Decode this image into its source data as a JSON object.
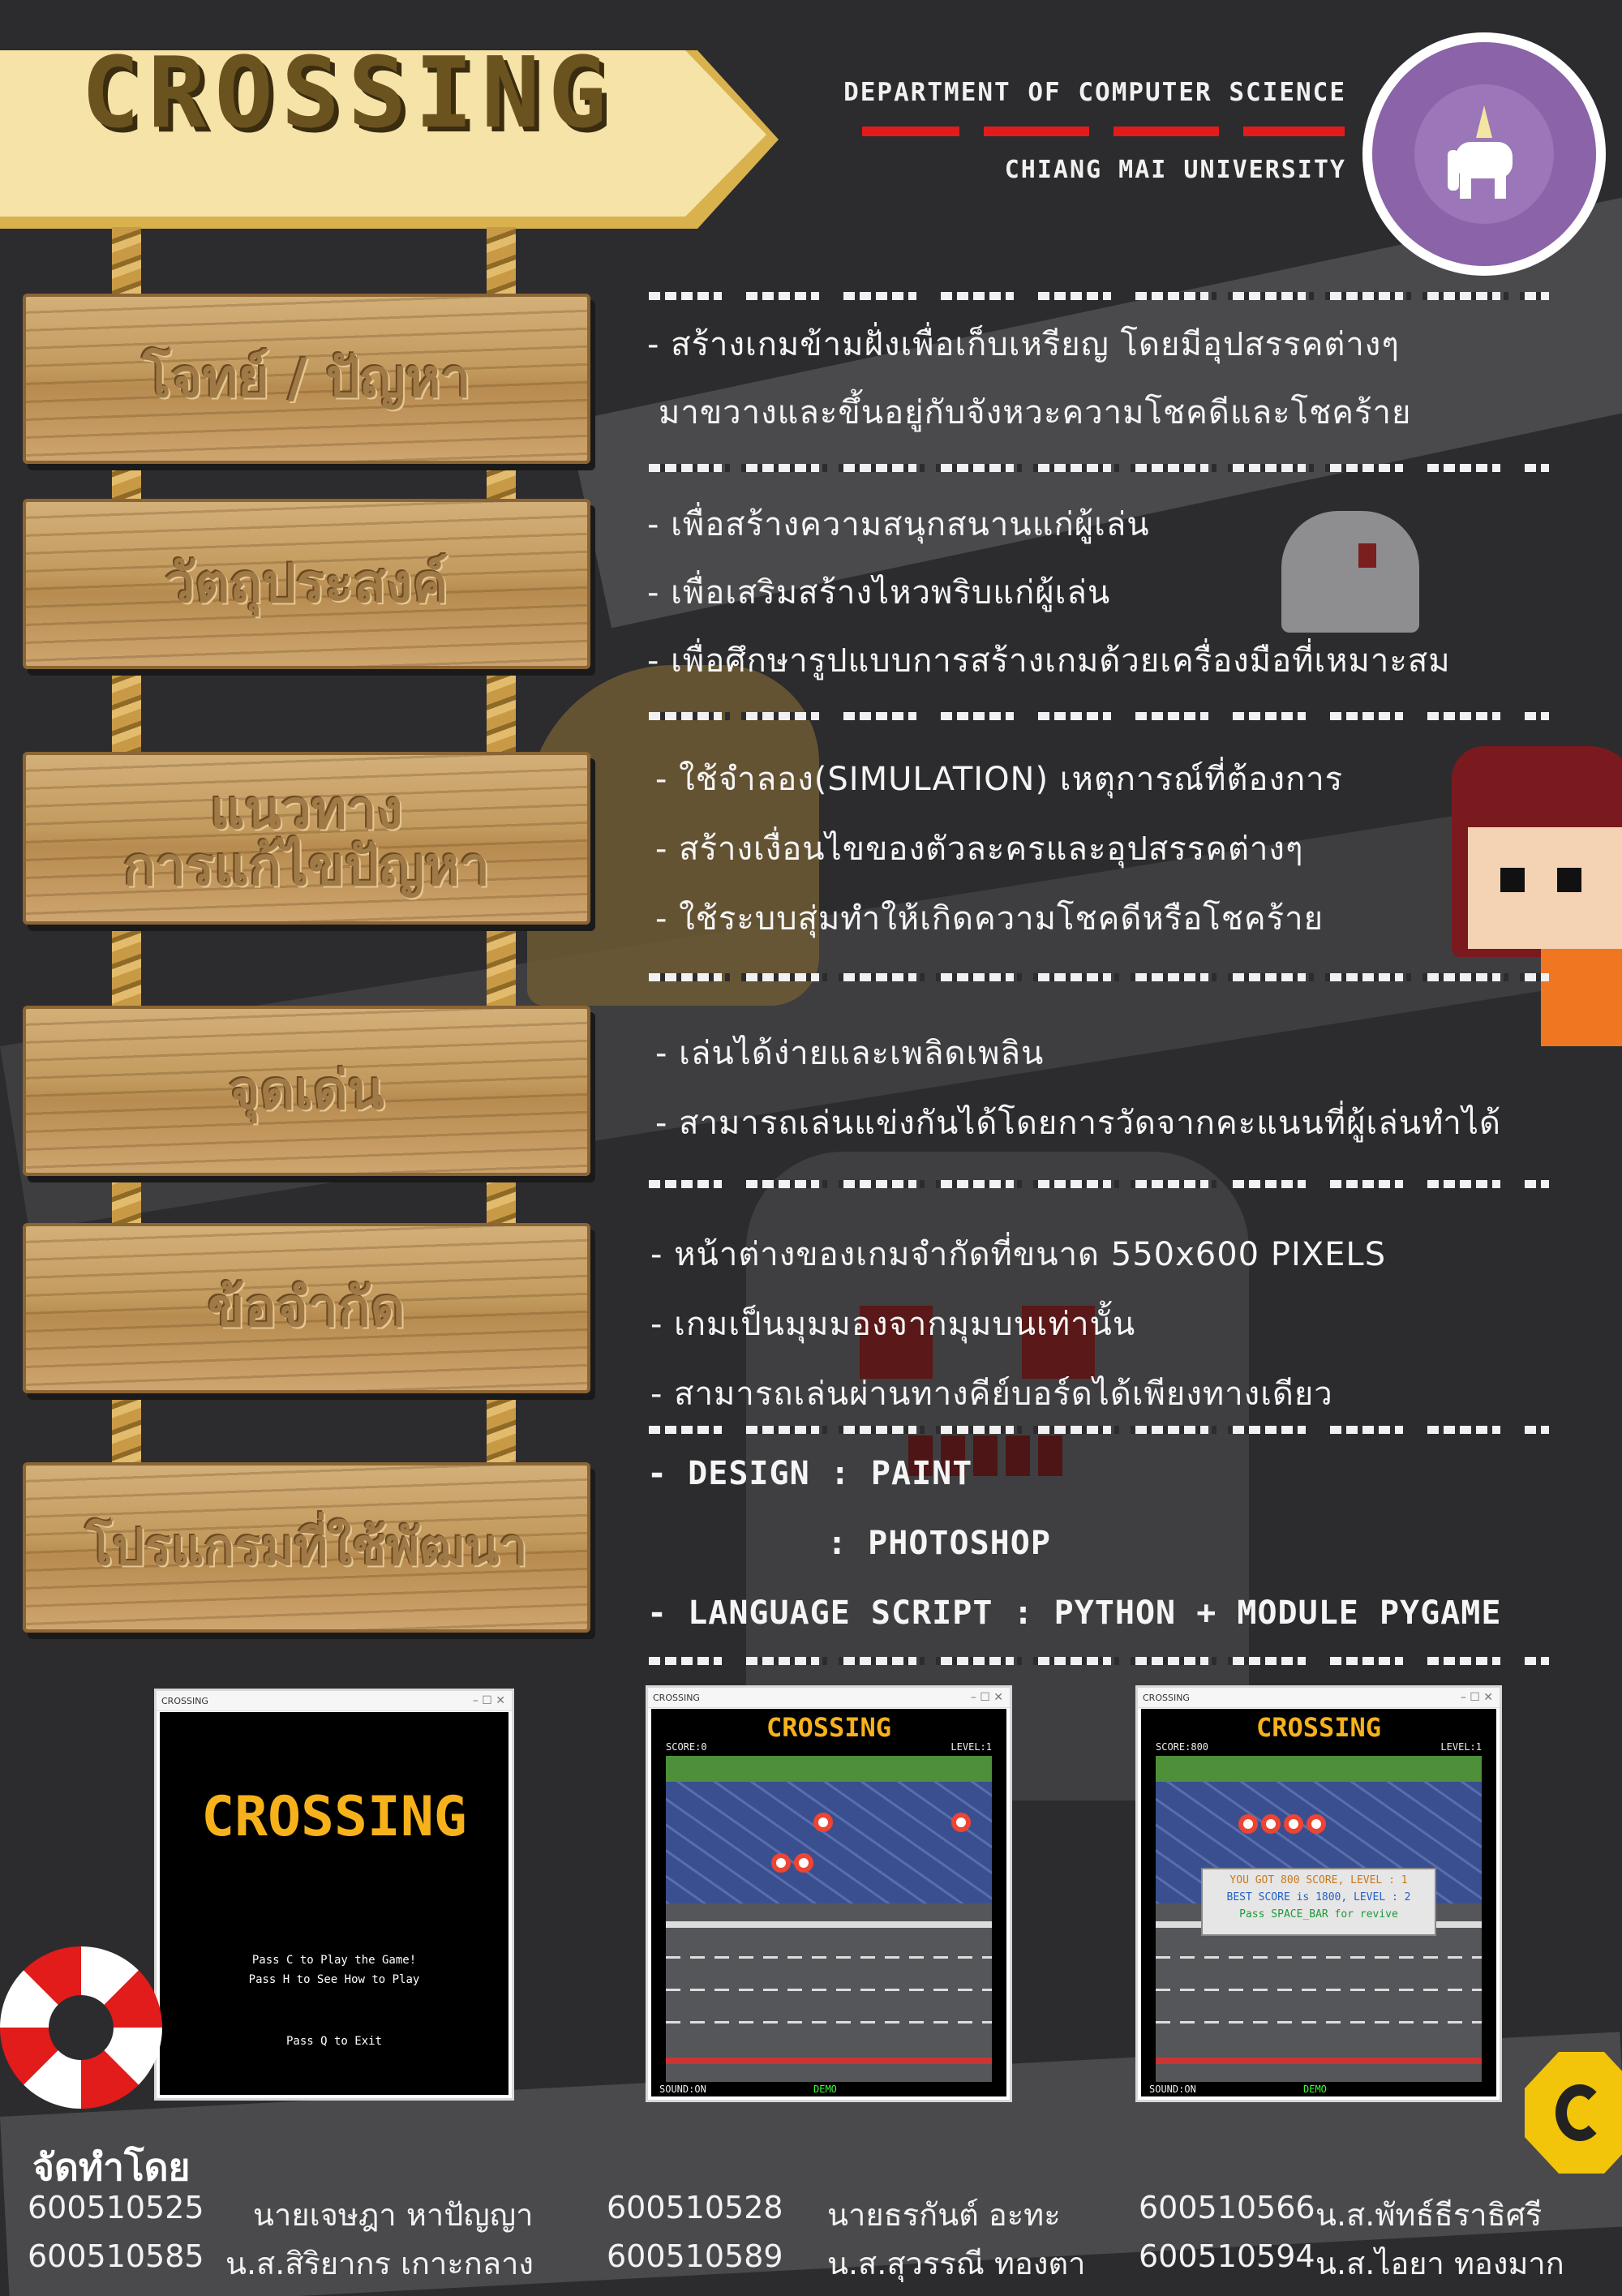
{
  "header": {
    "title": "CROSSING",
    "department": "DEPARTMENT OF COMPUTER SCIENCE",
    "university": "CHIANG MAI UNIVERSITY"
  },
  "sections": [
    {
      "board": "โจทย์ / ปัญหา",
      "lines": [
        "- สร้างเกมข้ามฝั่งเพื่อเก็บเหรียญ โดยมีอุปสรรคต่างๆ",
        " มาขวางและขึ้นอยู่กับจังหวะความโชคดีและโชคร้าย"
      ]
    },
    {
      "board": "วัตถุประสงค์",
      "lines": [
        "- เพื่อสร้างความสนุกสนานแก่ผู้เล่น",
        "- เพื่อเสริมสร้างไหวพริบแก่ผู้เล่น",
        "- เพื่อศึกษารูปแบบการสร้างเกมด้วยเครื่องมือที่เหมาะสม"
      ]
    },
    {
      "board": "แนวทาง การแก้ไขปัญหา",
      "board_line1": "แนวทาง",
      "board_line2": "การแก้ไขปัญหา",
      "lines": [
        "- ใช้จำลอง(SIMULATION) เหตุการณ์ที่ต้องการ",
        "- สร้างเงื่อนไขของตัวละครและอุปสรรคต่างๆ",
        "- ใช้ระบบสุ่มทำให้เกิดความโชคดีหรือโชคร้าย"
      ]
    },
    {
      "board": "จุดเด่น",
      "lines": [
        "- เล่นได้ง่ายและเพลิดเพลิน",
        "- สามารถเล่นแข่งกันได้โดยการวัดจากคะแนนที่ผู้เล่นทำได้"
      ]
    },
    {
      "board": "ข้อจำกัด",
      "lines": [
        "- หน้าต่างของเกมจำกัดที่ขนาด 550x600 PIXELS",
        "- เกมเป็นมุมมองจากมุมบนเท่านั้น",
        "- สามารถเล่นผ่านทางคีย์บอร์ดได้เพียงทางเดียว"
      ]
    },
    {
      "board": "โปรแกรมที่ใช้พัฒนา",
      "lines": [
        "- DESIGN : PAINT",
        ": PHOTOSHOP",
        "- LANGUAGE SCRIPT : PYTHON + MODULE PYGAME"
      ]
    }
  ],
  "screenshots": {
    "window_title": "CROSSING",
    "menu": {
      "title": "CROSSING",
      "line1": "Pass C to Play the Game!",
      "line2": "Pass H to See How to Play",
      "line3": "Pass Q to Exit"
    },
    "game1": {
      "title": "CROSSING",
      "score": "SCORE:0",
      "level": "LEVEL:1",
      "sound": "SOUND:ON",
      "demo": "DEMO"
    },
    "game2": {
      "title": "CROSSING",
      "score": "SCORE:800",
      "level": "LEVEL:1",
      "sound": "SOUND:ON",
      "demo": "DEMO",
      "popup1": "YOU GOT 800 SCORE, LEVEL : 1",
      "popup2": "BEST SCORE is 1800, LEVEL : 2",
      "popup3": "Pass SPACE_BAR for revive"
    }
  },
  "credits": {
    "heading": "จัดทำโดย",
    "people": [
      {
        "id": "600510525",
        "name": "นายเจษฎา หาปัญญา"
      },
      {
        "id": "600510528",
        "name": "นายธรกันต์ อะทะ"
      },
      {
        "id": "600510566",
        "name": "น.ส.พัทธ์ธีราธิศรี"
      },
      {
        "id": "600510585",
        "name": "น.ส.สิริยากร เกาะกลาง"
      },
      {
        "id": "600510589",
        "name": "น.ส.สุวรรณี ทองตา"
      },
      {
        "id": "600510594",
        "name": "น.ส.ไอยา ทองมาก"
      }
    ]
  },
  "colors": {
    "background": "#2c2c2e",
    "banner": "#f5e3a8",
    "accent_red": "#e21b1b",
    "board_wood": "#c29a5e",
    "seal_purple": "#8b63a8",
    "game_title": "#f7b21b"
  }
}
